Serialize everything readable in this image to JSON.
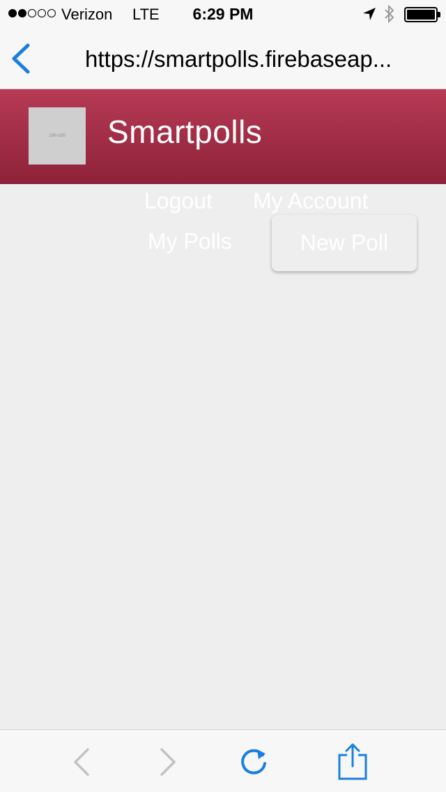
{
  "status_bar": {
    "carrier": "Verizon",
    "network": "LTE",
    "time": "6:29 PM",
    "signal_bars_filled": 2,
    "signal_bars_total": 5
  },
  "url_bar": {
    "url": "https://smartpolls.firebaseap..."
  },
  "header": {
    "logo_text": "100×100",
    "title": "Smartpolls",
    "color": "#a3304a"
  },
  "nav": {
    "logout": "Logout",
    "my_account": "My Account",
    "my_polls": "My Polls",
    "new_poll": "New Poll"
  },
  "toolbar": {
    "accent": "#1a7fe0",
    "icons": [
      "back-icon",
      "forward-icon",
      "reload-icon",
      "share-icon"
    ]
  }
}
